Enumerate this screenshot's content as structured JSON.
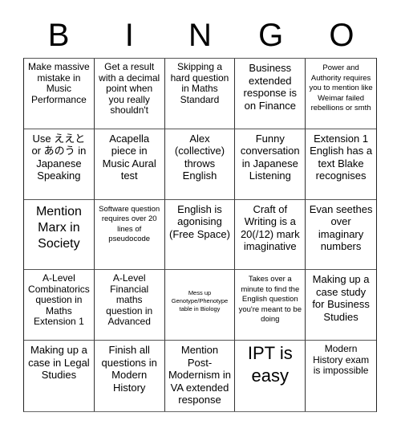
{
  "header": {
    "letters": [
      "B",
      "I",
      "N",
      "G",
      "O"
    ]
  },
  "cells": [
    {
      "text": "Make massive mistake in Music Performance",
      "size": "sm"
    },
    {
      "text": "Get a result with a decimal point when you really shouldn't",
      "size": "sm"
    },
    {
      "text": "Skipping a hard question in Maths Standard",
      "size": "sm"
    },
    {
      "text": "Business extended response is on Finance",
      "size": "md"
    },
    {
      "text": "Power and Authority requires you to mention like Weimar failed rebellions or smth",
      "size": "xs"
    },
    {
      "text": "Use ええと or あのう in Japanese Speaking",
      "size": "md"
    },
    {
      "text": "Acapella piece in Music Aural test",
      "size": "md"
    },
    {
      "text": "Alex (collective) throws English",
      "size": "md"
    },
    {
      "text": "Funny conversation in Japanese Listening",
      "size": "md"
    },
    {
      "text": "Extension 1 English has a text Blake recognises",
      "size": "md"
    },
    {
      "text": "Mention Marx in Society",
      "size": "lg"
    },
    {
      "text": "Software question requires over 20 lines of pseudocode",
      "size": "xs"
    },
    {
      "text": "English is agonising (Free Space)",
      "size": "md"
    },
    {
      "text": "Craft of Writing is a 20(/12) mark imaginative",
      "size": "md"
    },
    {
      "text": "Evan seethes over imaginary numbers",
      "size": "md"
    },
    {
      "text": "A-Level Combinatorics question in Maths Extension 1",
      "size": "sm"
    },
    {
      "text": "A-Level Financial maths question in Advanced",
      "size": "sm"
    },
    {
      "text": "Mess up Genotype/Phenotype table in Biology",
      "size": "xxs"
    },
    {
      "text": "Takes over a minute to find the English question you're meant to be doing",
      "size": "xs"
    },
    {
      "text": "Making up a case study for Business Studies",
      "size": "md"
    },
    {
      "text": "Making up a case in Legal Studies",
      "size": "md"
    },
    {
      "text": "Finish all questions in Modern History",
      "size": "md"
    },
    {
      "text": "Mention Post-Modernism in VA extended response",
      "size": "md"
    },
    {
      "text": "IPT is easy",
      "size": "xl"
    },
    {
      "text": "Modern History exam is impossible",
      "size": "sm"
    }
  ]
}
